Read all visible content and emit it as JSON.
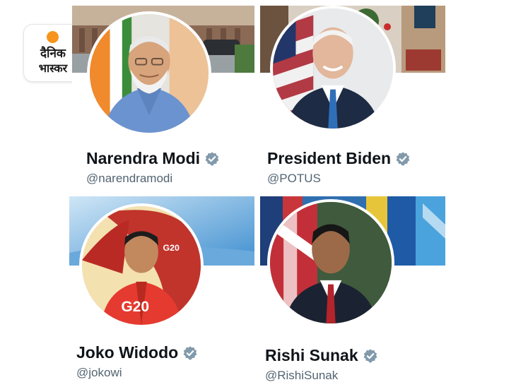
{
  "brand": {
    "line1": "दैनिक",
    "line2": "भास्कर",
    "accent": "#f7941d"
  },
  "profiles": [
    {
      "name": "Narendra Modi",
      "handle": "@narendramodi",
      "verified": true
    },
    {
      "name": "President Biden",
      "handle": "@POTUS",
      "verified": true
    },
    {
      "name": "Joko Widodo",
      "handle": "@jokowi",
      "verified": true
    },
    {
      "name": "Rishi Sunak",
      "handle": "@RishiSunak",
      "verified": true
    }
  ],
  "colors": {
    "verified": "#829aab",
    "handle": "#536471",
    "name": "#0f1419"
  }
}
